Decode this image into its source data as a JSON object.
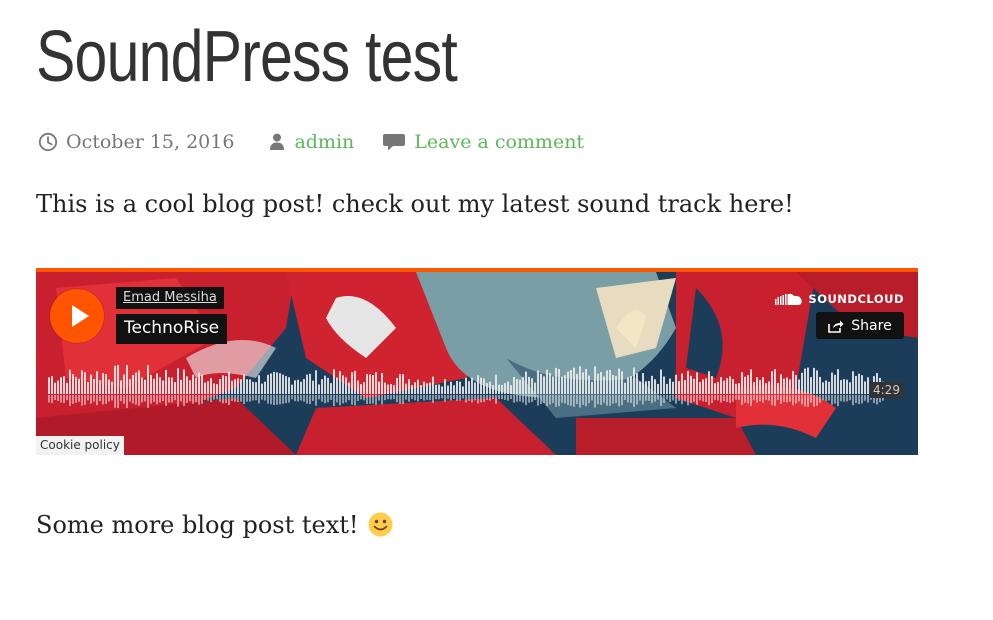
{
  "post": {
    "title": "SoundPress test",
    "date": "October 15, 2016",
    "author": "admin",
    "comment_link": "Leave a comment",
    "paragraph1": "This is a cool blog post! check out my latest sound track here!",
    "paragraph2": "Some more blog post text!"
  },
  "meta_icons": [
    "clock-icon",
    "user-icon",
    "comment-icon"
  ],
  "embed": {
    "artist": "Emad Messiha",
    "track": "TechnoRise",
    "brand": "SOUNDCLOUD",
    "share_label": "Share",
    "duration": "4:29",
    "cookie_label": "Cookie policy",
    "accent_color": "#ff5500"
  },
  "colors": {
    "link": "#5cb85c",
    "meta": "#777777",
    "text": "#222222"
  }
}
